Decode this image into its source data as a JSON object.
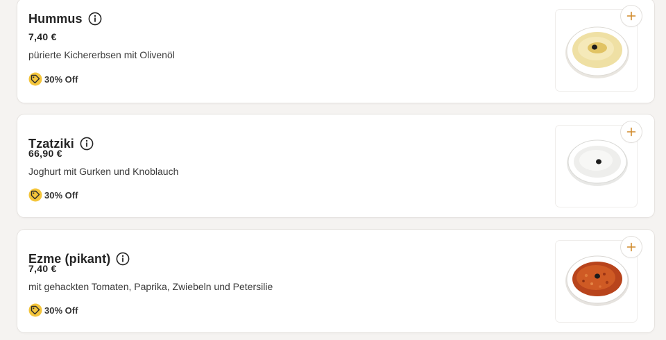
{
  "menu": {
    "items": [
      {
        "title": "Hummus",
        "price": "7,40 €",
        "description": "pürierte Kichererbsen mit Olivenöl",
        "badge": "30% Off",
        "image_icon": "hummus-dish-icon"
      },
      {
        "title": "Tzatziki",
        "price": "66,90 €",
        "description": "Joghurt mit Gurken und Knoblauch",
        "badge": "30% Off",
        "image_icon": "tzatziki-dish-icon"
      },
      {
        "title": "Ezme (pikant)",
        "price": "7,40 €",
        "description": "mit gehackten Tomaten, Paprika, Zwiebeln und Petersilie",
        "badge": "30% Off",
        "image_icon": "ezme-dish-icon"
      }
    ]
  },
  "colors": {
    "accent": "#d08a2c",
    "badge_fill": "#f4c53b",
    "background": "#f5f3f1"
  }
}
